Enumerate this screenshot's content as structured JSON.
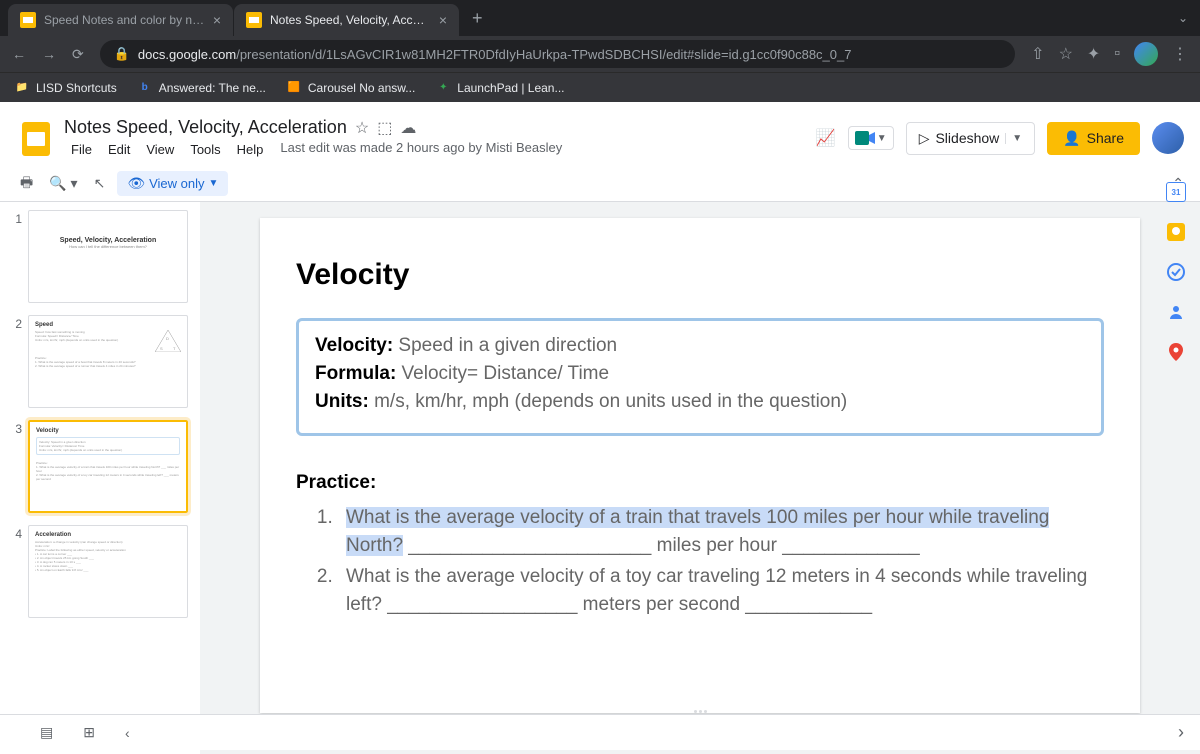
{
  "browser": {
    "tabs": [
      {
        "label": "Speed Notes and color by num"
      },
      {
        "label": "Notes Speed, Velocity, Acceler"
      }
    ],
    "url_host": "docs.google.com",
    "url_path": "/presentation/d/1LsAGvCIR1w81MH2FTR0DfdIyHaUrkpa-TPwdSDBCHSI/edit#slide=id.g1cc0f90c88c_0_7"
  },
  "bookmarks": [
    "LISD Shortcuts",
    "Answered: The ne...",
    "Carousel No answ...",
    "LaunchPad | Lean..."
  ],
  "doc": {
    "title": "Notes Speed, Velocity, Acceleration",
    "menus": [
      "File",
      "Edit",
      "View",
      "Tools",
      "Help"
    ],
    "last_edit": "Last edit was made 2 hours ago by Misti Beasley",
    "slideshow": "Slideshow",
    "share": "Share",
    "view_only": "View only"
  },
  "thumbs": [
    {
      "n": "1",
      "title": "Speed, Velocity, Acceleration",
      "sub": "How can I tell the difference between them?"
    },
    {
      "n": "2",
      "title": "Speed"
    },
    {
      "n": "3",
      "title": "Velocity"
    },
    {
      "n": "4",
      "title": "Acceleration"
    }
  ],
  "slide": {
    "heading": "Velocity",
    "def_label": "Velocity:",
    "def": " Speed in a given direction",
    "formula_label": "Formula:",
    "formula": " Velocity= Distance/ Time",
    "units_label": "Units:",
    "units": " m/s, km/hr, mph (depends on units used in the question)",
    "practice": "Practice:",
    "q1a": "What is the average velocity of a train that travels 100 miles per hour while traveling North?",
    "q1b": " _______________________ miles per hour _____________",
    "q2": "What is the average velocity of a toy car traveling 12 meters in 4 seconds while traveling left? __________________ meters per second ____________"
  },
  "calendar": "31"
}
